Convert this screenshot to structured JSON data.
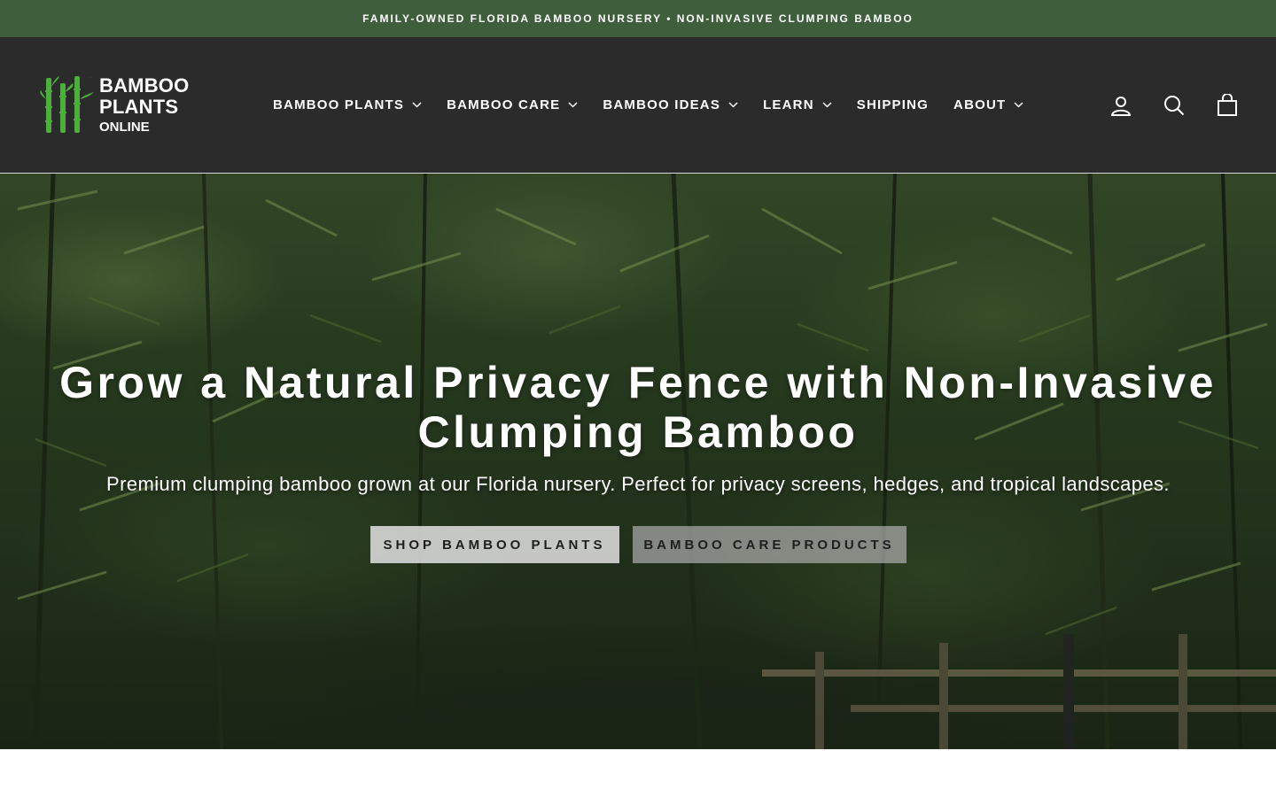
{
  "announcement": {
    "text": "FAMILY-OWNED FLORIDA BAMBOO NURSERY • NON-INVASIVE CLUMPING BAMBOO"
  },
  "logo": {
    "line1": "BAMBOO",
    "line2": "PLANTS",
    "line3": "ONLINE",
    "icon": "bamboo-stalks-icon"
  },
  "nav": {
    "items": [
      {
        "label": "BAMBOO PLANTS",
        "dropdown": true
      },
      {
        "label": "BAMBOO CARE",
        "dropdown": true
      },
      {
        "label": "BAMBOO IDEAS",
        "dropdown": true
      },
      {
        "label": "LEARN",
        "dropdown": true
      },
      {
        "label": "SHIPPING",
        "dropdown": false
      },
      {
        "label": "ABOUT",
        "dropdown": true
      }
    ]
  },
  "header_icons": [
    "account-icon",
    "search-icon",
    "cart-icon"
  ],
  "hero": {
    "title": "Grow a Natural Privacy Fence with Non-Invasive Clumping Bamboo",
    "subtitle": "Premium clumping bamboo grown at our Florida nursery. Perfect for privacy screens, hedges, and tropical landscapes.",
    "primary_button": "SHOP BAMBOO PLANTS",
    "secondary_button": "BAMBOO CARE PRODUCTS"
  },
  "colors": {
    "announcement_bg": "#3f5e3b",
    "header_bg": "#2b2b2b",
    "logo_green": "#4caf3c"
  }
}
